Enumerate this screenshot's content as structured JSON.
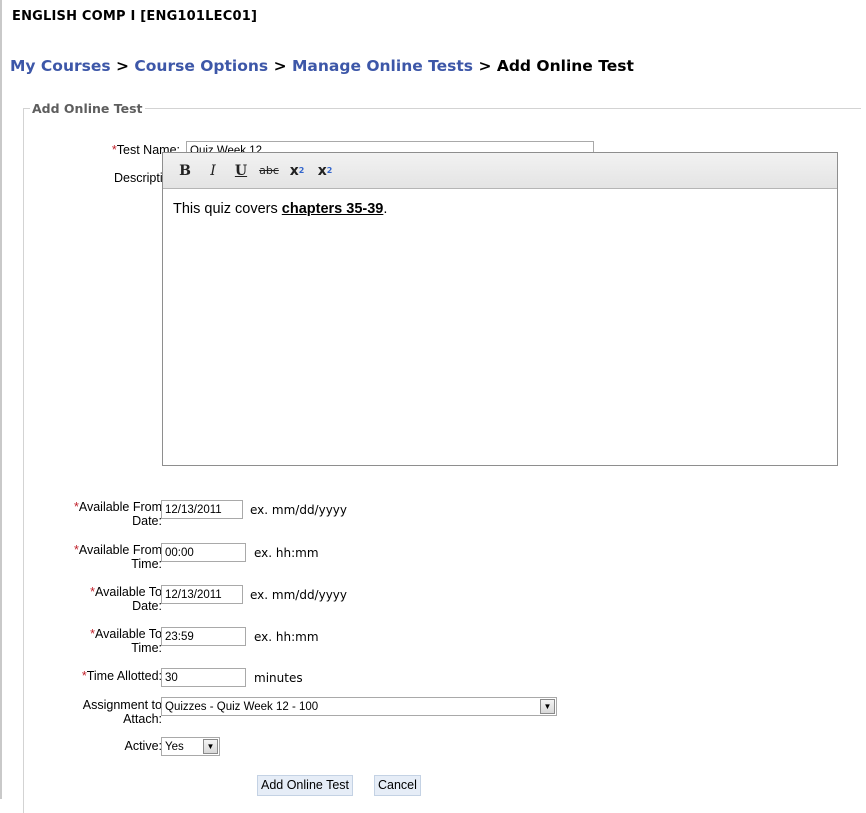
{
  "course_title": "ENGLISH COMP I [ENG101LEC01]",
  "breadcrumb": {
    "my_courses": "My Courses",
    "course_options": "Course Options",
    "manage_online_tests": "Manage Online Tests",
    "current": "Add Online Test",
    "separator": ">"
  },
  "form": {
    "legend": "Add Online Test",
    "required_mark": "*",
    "test_name": {
      "label": "Test Name:",
      "value": "Quiz Week 12"
    },
    "description": {
      "label": "Description:",
      "toolbar": {
        "bold": "B",
        "italic": "I",
        "underline": "U",
        "strike": "abc",
        "subscript": "x",
        "subscript_mark": "2",
        "superscript": "x",
        "superscript_mark": "2"
      },
      "text_before": "This quiz covers ",
      "text_link": "chapters 35-39",
      "text_after": "."
    },
    "available_from_date": {
      "label_line1": "Available From",
      "label_line2": "Date:",
      "value": "12/13/2011",
      "hint": "ex. mm/dd/yyyy"
    },
    "available_from_time": {
      "label_line1": "Available From",
      "label_line2": "Time:",
      "value": "00:00",
      "hint": "ex. hh:mm"
    },
    "available_to_date": {
      "label_line1": "Available To",
      "label_line2": "Date:",
      "value": "12/13/2011",
      "hint": "ex. mm/dd/yyyy"
    },
    "available_to_time": {
      "label_line1": "Available To",
      "label_line2": "Time:",
      "value": "23:59",
      "hint": "ex. hh:mm"
    },
    "time_allotted": {
      "label": "Time Allotted:",
      "value": "30",
      "hint": "minutes"
    },
    "assignment": {
      "label_line1": "Assignment to",
      "label_line2": "Attach:",
      "value": "Quizzes - Quiz Week 12 - 100"
    },
    "active": {
      "label": "Active:",
      "value": "Yes"
    },
    "submit_label": "Add Online Test",
    "cancel_label": "Cancel"
  },
  "colors": {
    "link": "#3d57a8",
    "required": "#c0202a",
    "legend": "#5e5e5e",
    "button_bg": "#e6edf7"
  },
  "icons": {
    "dropdown": "chevron-down-icon"
  }
}
